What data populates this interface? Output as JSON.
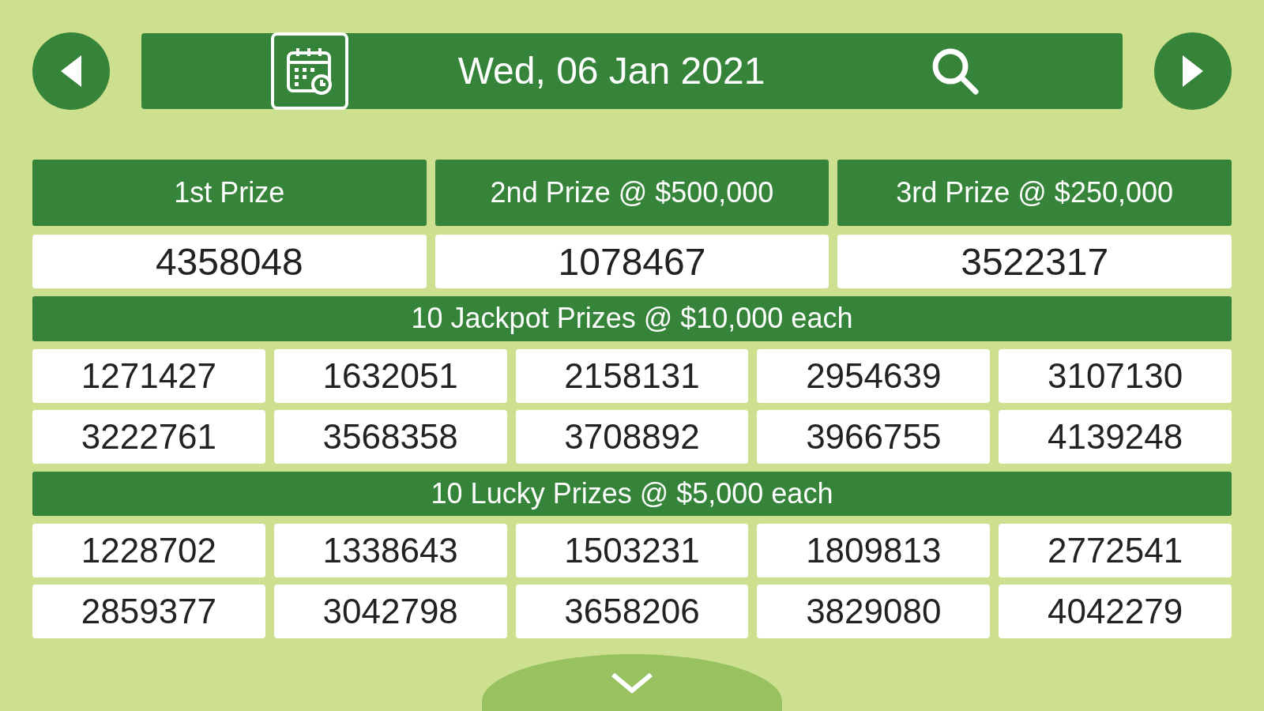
{
  "date": "Wed, 06 Jan 2021",
  "top_prizes": [
    {
      "label": "1st Prize",
      "number": "4358048"
    },
    {
      "label": "2nd Prize @ $500,000",
      "number": "1078467"
    },
    {
      "label": "3rd Prize @ $250,000",
      "number": "3522317"
    }
  ],
  "groups": [
    {
      "title": "10 Jackpot Prizes @ $10,000 each",
      "numbers": [
        "1271427",
        "1632051",
        "2158131",
        "2954639",
        "3107130",
        "3222761",
        "3568358",
        "3708892",
        "3966755",
        "4139248"
      ]
    },
    {
      "title": "10 Lucky Prizes @ $5,000 each",
      "numbers": [
        "1228702",
        "1338643",
        "1503231",
        "1809813",
        "2772541",
        "2859377",
        "3042798",
        "3658206",
        "3829080",
        "4042279"
      ]
    }
  ]
}
